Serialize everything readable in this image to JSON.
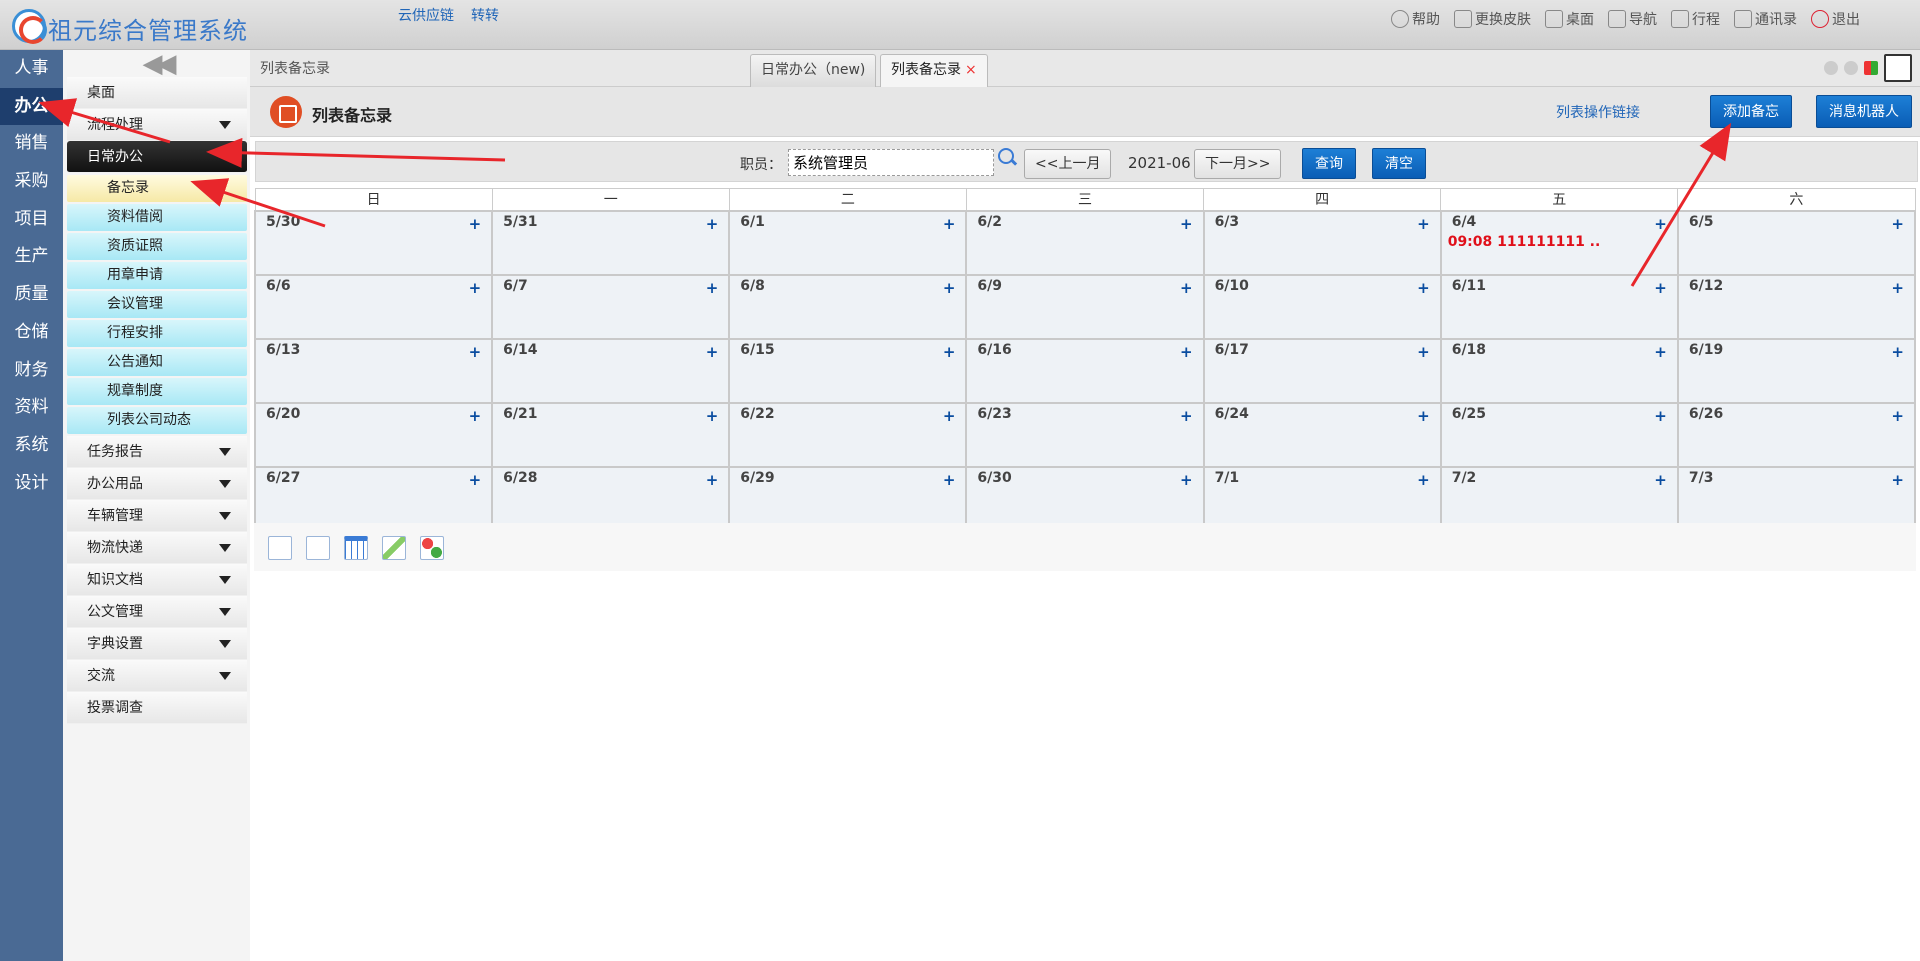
{
  "app": {
    "title": "祖元综合管理系统",
    "top_links": [
      "云供应链",
      "转转"
    ],
    "top_actions": [
      {
        "label": "帮助",
        "icon": "help-icon"
      },
      {
        "label": "更换皮肤",
        "icon": "shirt-icon"
      },
      {
        "label": "桌面",
        "icon": "home-icon"
      },
      {
        "label": "导航",
        "icon": "grid-icon"
      },
      {
        "label": "行程",
        "icon": "calendar-icon"
      },
      {
        "label": "通讯录",
        "icon": "contact-icon"
      },
      {
        "label": "退出",
        "icon": "power-icon"
      }
    ]
  },
  "rail": [
    "人事",
    "办公",
    "销售",
    "采购",
    "项目",
    "生产",
    "质量",
    "仓储",
    "财务",
    "资料",
    "系统",
    "设计"
  ],
  "rail_active": "办公",
  "menu": {
    "collapse": "<<",
    "desktop": "桌面",
    "flow": "流程处理",
    "daily": "日常办公",
    "sub_items": [
      "备忘录",
      "资料借阅",
      "资质证照",
      "用章申请",
      "会议管理",
      "行程安排",
      "公告通知",
      "规章制度",
      "列表公司动态"
    ],
    "groups": [
      "任务报告",
      "办公用品",
      "车辆管理",
      "物流快递",
      "知识文档",
      "公文管理",
      "字典设置",
      "交流"
    ],
    "vote": "投票调查"
  },
  "breadcrumb": "列表备忘录",
  "tabs": [
    {
      "label": "日常办公（new)"
    },
    {
      "label": "列表备忘录",
      "close": "×"
    }
  ],
  "page": {
    "title": "列表备忘录",
    "link": "列表操作链接",
    "add_button": "添加备忘",
    "robot_button": "消息机器人"
  },
  "query": {
    "employee_label": "职员：",
    "employee_value": "系统管理员",
    "prev_month": "<<上一月",
    "month": "2021-06",
    "next_month": "下一月>>",
    "search": "查询",
    "clear": "清空"
  },
  "calendar": {
    "weekdays": [
      "日",
      "一",
      "二",
      "三",
      "四",
      "五",
      "六"
    ],
    "add_symbol": "+",
    "weeks": [
      [
        {
          "d": "5/30"
        },
        {
          "d": "5/31"
        },
        {
          "d": "6/1"
        },
        {
          "d": "6/2"
        },
        {
          "d": "6/3"
        },
        {
          "d": "6/4",
          "memo": "09:08  111111111 .."
        },
        {
          "d": "6/5"
        }
      ],
      [
        {
          "d": "6/6"
        },
        {
          "d": "6/7"
        },
        {
          "d": "6/8"
        },
        {
          "d": "6/9"
        },
        {
          "d": "6/10"
        },
        {
          "d": "6/11"
        },
        {
          "d": "6/12"
        }
      ],
      [
        {
          "d": "6/13"
        },
        {
          "d": "6/14"
        },
        {
          "d": "6/15"
        },
        {
          "d": "6/16"
        },
        {
          "d": "6/17"
        },
        {
          "d": "6/18"
        },
        {
          "d": "6/19"
        }
      ],
      [
        {
          "d": "6/20"
        },
        {
          "d": "6/21"
        },
        {
          "d": "6/22"
        },
        {
          "d": "6/23"
        },
        {
          "d": "6/24"
        },
        {
          "d": "6/25"
        },
        {
          "d": "6/26"
        }
      ],
      [
        {
          "d": "6/27"
        },
        {
          "d": "6/28"
        },
        {
          "d": "6/29"
        },
        {
          "d": "6/30"
        },
        {
          "d": "7/1"
        },
        {
          "d": "7/2"
        },
        {
          "d": "7/3"
        }
      ]
    ]
  },
  "tools": [
    "select-icon",
    "page-icon",
    "table-icon",
    "edit-icon",
    "puzzle-icon"
  ],
  "colors": {
    "rail": "#4a6a94",
    "accent": "#0a5db5",
    "memo": "#e0101a",
    "arrow": "#e8262b"
  }
}
